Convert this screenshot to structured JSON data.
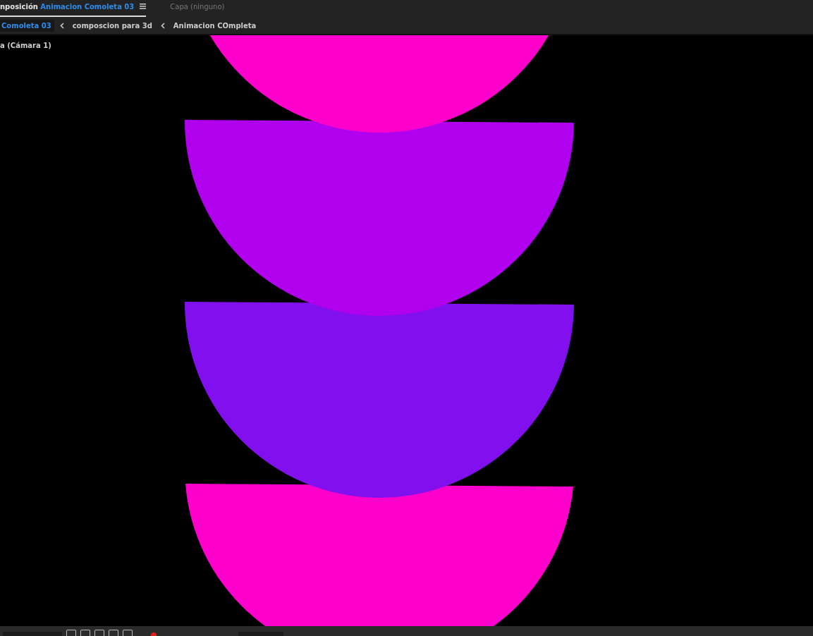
{
  "panel_tabs": [
    {
      "prefix": "nposición",
      "name": "Animacion Comoleta 03",
      "selected": true,
      "menu": true
    },
    {
      "prefix": "Capa",
      "name": "(ninguno)",
      "selected": false,
      "menu": false
    }
  ],
  "breadcrumbs": [
    {
      "label": "Comoleta 03",
      "selected": true
    },
    {
      "label": "composcion para 3d",
      "selected": false
    },
    {
      "label": "Animacion COmpleta",
      "selected": false
    }
  ],
  "viewer": {
    "camera_label": "a (Cámara 1)"
  }
}
